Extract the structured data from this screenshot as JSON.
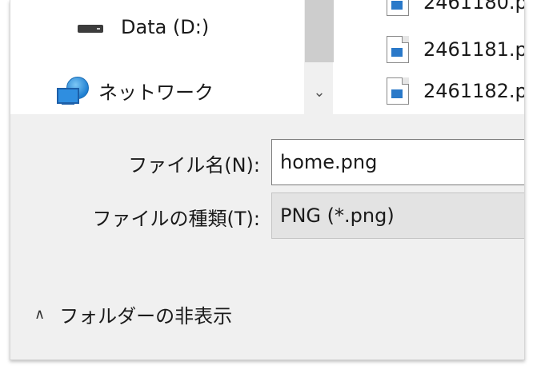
{
  "nav": {
    "items": [
      {
        "label": "Data (D:)",
        "icon": "drive-icon"
      },
      {
        "label": "ネットワーク",
        "icon": "network-icon"
      }
    ]
  },
  "scrollbar": {
    "down_glyph": "⌄"
  },
  "files": {
    "partial_label": "2461180.p",
    "items": [
      {
        "label": "2461181.p"
      },
      {
        "label": "2461182.p"
      }
    ]
  },
  "form": {
    "filename_label": "ファイル名(N):",
    "filename_value": "home.png",
    "filetype_label": "ファイルの種類(T):",
    "filetype_value": "PNG (*.png)"
  },
  "folders_toggle": {
    "label": "フォルダーの非表示",
    "chevron": "∧"
  },
  "colors": {
    "dialog_bg": "#f0f0f0",
    "list_bg": "#ffffff",
    "file_image_accent": "#2a79c9"
  }
}
